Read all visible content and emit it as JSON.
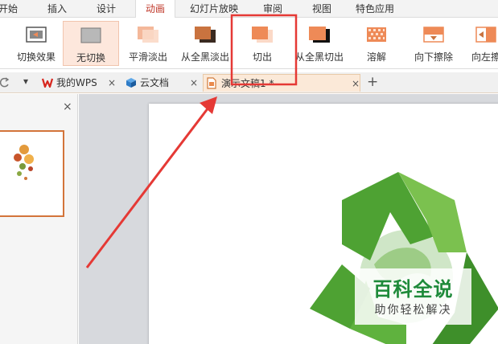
{
  "menubar": {
    "items": [
      "开始",
      "插入",
      "设计",
      "动画",
      "幻灯片放映",
      "审阅",
      "视图",
      "特色应用"
    ],
    "active": "动画"
  },
  "ribbon": {
    "effects": [
      {
        "label": "切换效果",
        "icon": "transition-effects-icon"
      },
      {
        "label": "无切换",
        "icon": "no-transition-icon",
        "selected": true
      },
      {
        "label": "平滑淡出",
        "icon": "fade-smoothly-icon"
      },
      {
        "label": "从全黑淡出",
        "icon": "fade-through-black-icon"
      },
      {
        "label": "切出",
        "icon": "cut-icon"
      },
      {
        "label": "从全黑切出",
        "icon": "cut-through-black-icon"
      },
      {
        "label": "溶解",
        "icon": "dissolve-icon"
      },
      {
        "label": "向下擦除",
        "icon": "wipe-down-icon"
      },
      {
        "label": "向左擦",
        "icon": "wipe-left-icon"
      }
    ]
  },
  "tabbar": {
    "tabs": [
      {
        "label": "我的WPS",
        "icon": "wps-logo-icon"
      },
      {
        "label": "云文档",
        "icon": "cloud-docs-cube-icon"
      },
      {
        "label": "演示文稿1 *",
        "icon": "presentation-file-icon",
        "active": true
      }
    ],
    "close_glyph": "×",
    "add_glyph": "+",
    "dropdown_glyph": "▾"
  },
  "slides_panel": {
    "close_glyph": "×"
  },
  "watermark": {
    "title": "百科全说",
    "subtitle": "助你轻松解决"
  },
  "colors": {
    "accent": "#c0392b",
    "annotation_red": "#e53935",
    "effect_orange": "#ee8a57",
    "recycle_green": "#4ea233"
  }
}
